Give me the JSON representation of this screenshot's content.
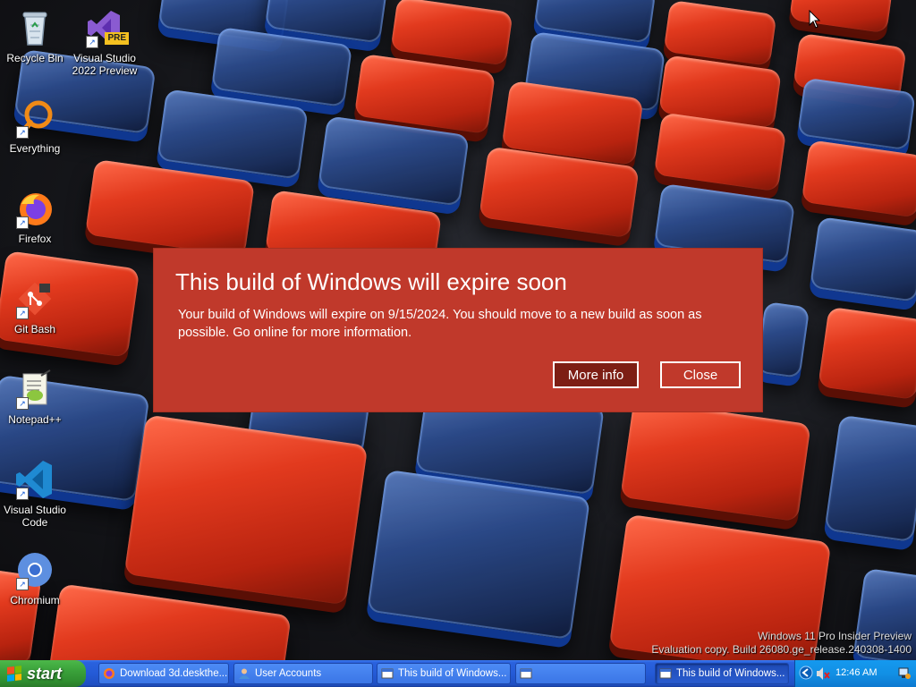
{
  "desktop_icons": [
    {
      "label": "Recycle Bin",
      "icon": "recycle-bin-icon"
    },
    {
      "label": "Visual Studio 2022 Preview",
      "icon": "visual-studio-preview-icon",
      "badge": "PRE"
    },
    {
      "label": "Everything",
      "icon": "everything-search-icon"
    },
    {
      "label": "Firefox",
      "icon": "firefox-icon"
    },
    {
      "label": "Git Bash",
      "icon": "git-bash-icon"
    },
    {
      "label": "Notepad++",
      "icon": "notepad-plus-plus-icon"
    },
    {
      "label": "Visual Studio Code",
      "icon": "vscode-icon"
    },
    {
      "label": "Chromium",
      "icon": "chromium-icon"
    }
  ],
  "dialog": {
    "title": "This build of Windows will expire soon",
    "body": "Your build of Windows will expire on 9/15/2024. You should move to a new build as soon as possible. Go online for more information.",
    "more_info_label": "More info",
    "close_label": "Close",
    "background_color": "#c0392b"
  },
  "watermark": {
    "line1": "Windows 11 Pro Insider Preview",
    "line2": "Evaluation copy. Build 26080.ge_release.240308-1400"
  },
  "taskbar": {
    "start_label": "start",
    "tasks": [
      {
        "label": "Download 3d.deskthe...",
        "icon": "firefox-icon"
      },
      {
        "label": "User Accounts",
        "icon": "user-accounts-icon"
      },
      {
        "label": "This build of Windows...",
        "icon": "window-icon"
      },
      {
        "label": "",
        "icon": "window-icon"
      },
      {
        "label": "This build of Windows...",
        "icon": "window-icon"
      }
    ],
    "tray": {
      "clock": "12:46 AM",
      "icons": [
        "back-arrow-icon",
        "volume-muted-icon",
        "network-icon"
      ]
    }
  },
  "colors": {
    "taskbar_blue": "#245ad6",
    "start_green": "#3aa13a",
    "tray_blue": "#1290e5"
  }
}
